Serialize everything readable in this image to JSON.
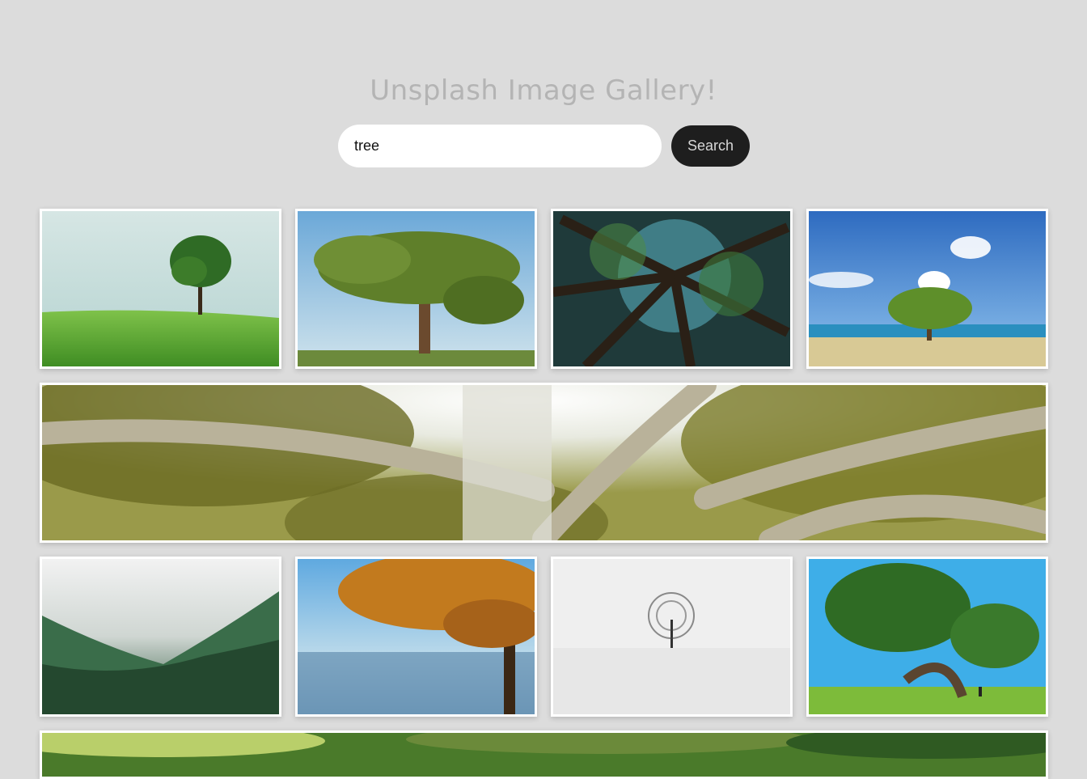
{
  "page": {
    "title": "Unsplash Image Gallery!"
  },
  "search": {
    "value": "tree",
    "button_label": "Search"
  },
  "gallery": [
    {
      "name": "tree on green grass hill"
    },
    {
      "name": "large tree on meadow"
    },
    {
      "name": "looking up at forest canopy"
    },
    {
      "name": "tree on tropical beach"
    },
    {
      "name": "sunlit tree branches panorama"
    },
    {
      "name": "misty forest mountains"
    },
    {
      "name": "autumn tree by lake"
    },
    {
      "name": "lone tree in snow"
    },
    {
      "name": "leaning tree on grass with person"
    },
    {
      "name": "green canopy panorama"
    }
  ]
}
